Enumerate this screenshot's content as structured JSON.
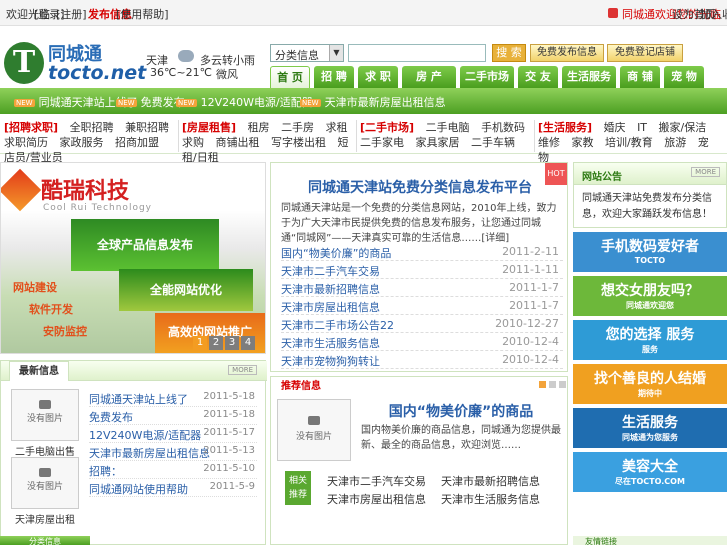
{
  "topbar": {
    "left_links": [
      "欢迎光临",
      "[登录]",
      "[注册]",
      "[退出登录]"
    ],
    "highlight": "发布信息",
    "help": "[使用帮助]",
    "right_promo": "同城通欢迎您的光临",
    "right_links": [
      "设为首页",
      "加入收藏"
    ]
  },
  "logo": {
    "mark": "T",
    "cn": "同城通",
    "en": "tocto.net"
  },
  "weather": {
    "city": "天津",
    "desc": "多云转小雨",
    "temp": "36℃~21℃",
    "wind": "微风"
  },
  "search": {
    "category": "分类信息",
    "placeholder": "",
    "button": "搜 索"
  },
  "action_buttons": [
    "免费发布信息",
    "免费登记店铺"
  ],
  "nav_tabs": [
    "首 页",
    "招 聘",
    "求 职",
    "房 产",
    "二手市场",
    "交 友",
    "生活服务",
    "商 铺",
    "宠 物"
  ],
  "green_bar": [
    {
      "tag": "NEW",
      "text": "同城通天津站上线了"
    },
    {
      "tag": "NEW",
      "text": "免费发布"
    },
    {
      "tag": "NEW",
      "text": "12V240W电源/适配器"
    },
    {
      "tag": "NEW",
      "text": "天津市最新房屋出租信息"
    }
  ],
  "categories": [
    {
      "head": "[招聘求职]",
      "links": [
        "全职招聘",
        "兼职招聘",
        "求职简历",
        "家政服务",
        "招商加盟",
        "店员/营业员"
      ]
    },
    {
      "head": "[房屋租售]",
      "links": [
        "租房",
        "二手房",
        "求租求购",
        "商铺出租",
        "写字楼出租",
        "短租/日租"
      ]
    },
    {
      "head": "[二手市场]",
      "links": [
        "二手电脑",
        "手机数码",
        "二手家电",
        "家具家居",
        "二手车辆"
      ]
    },
    {
      "head": "[生活服务]",
      "links": [
        "婚庆",
        "IT",
        "搬家/保洁",
        "维修",
        "家教",
        "培训/教育",
        "旅游",
        "宠物"
      ]
    }
  ],
  "banner": {
    "brand": "酷瑞科技",
    "brand_en": "Cool Rui Technology",
    "block1": "全球产品信息发布",
    "block2": "全能网站优化",
    "block3": "高效的网站推广",
    "side": [
      "网站建设",
      "软件开发",
      "安防监控"
    ],
    "pages": [
      "1",
      "2",
      "3",
      "4"
    ]
  },
  "headline": {
    "title": "同城通天津站免费分类信息发布平台",
    "summary": "同城通天津站是一个免费的分类信息网站，2010年上线，致力于为广大天津市民提供免费的信息发布服务，让您通过同城通“同城网”——天津真实可靠的生活信息……[详细]",
    "hot": "HOT",
    "news": [
      {
        "title": "国内“物美价廉”的商品",
        "date": "2011-2-11"
      },
      {
        "title": "天津市二手汽车交易",
        "date": "2011-1-11"
      },
      {
        "title": "天津市最新招聘信息",
        "date": "2011-1-7"
      },
      {
        "title": "天津市房屋出租信息",
        "date": "2011-1-7"
      },
      {
        "title": "天津市二手市场公告22",
        "date": "2010-12-27"
      },
      {
        "title": "天津市生活服务信息",
        "date": "2010-12-4"
      },
      {
        "title": "天津市宠物狗狗转让",
        "date": "2010-12-4"
      }
    ]
  },
  "notice": {
    "label": "网站公告",
    "more": "MORE",
    "body": "同城通天津站免费发布分类信息，欢迎大家踊跃发布信息！"
  },
  "right_ads": [
    {
      "big": "手机数码爱好者",
      "small": "TOCTO",
      "color": "#3a8fd0"
    },
    {
      "big": "想交女朋友吗？",
      "small": "同城通欢迎您",
      "color": "#6db83a"
    },
    {
      "big": "您的选择 服务",
      "small": "服务",
      "color": "#2e9bd6"
    },
    {
      "big": "找个善良的人结婚",
      "small": "期待中",
      "color": "#f0a020"
    },
    {
      "big": "生活服务",
      "small": "同城通为您服务",
      "color": "#1f6db0"
    },
    {
      "big": "美容大全",
      "small": "尽在TOCTO.COM",
      "color": "#3aa0e0"
    }
  ],
  "newlist": {
    "tab": "最新信息",
    "more": "MORE",
    "thumbs": [
      {
        "label": "没有图片",
        "caption": "二手电脑出售"
      },
      {
        "label": "没有图片",
        "caption": "天津房屋出租"
      }
    ],
    "rows": [
      {
        "title": "同城通天津站上线了",
        "date": "2011-5-18"
      },
      {
        "title": "免费发布",
        "date": "2011-5-18"
      },
      {
        "title": "12V240W电源/适配器",
        "date": "2011-5-17"
      },
      {
        "title": "天津市最新房屋出租信息",
        "date": "2011-5-13"
      },
      {
        "title": "招聘：",
        "date": "2011-5-10"
      },
      {
        "title": "同城通网站使用帮助",
        "date": "2011-5-9"
      }
    ]
  },
  "featured": {
    "label": "推荐信息",
    "pic": "没有图片",
    "title": "国内“物美价廉”的商品",
    "summary": "国内物美价廉的商品信息，同城通为您提供最新、最全的商品信息，欢迎浏览……",
    "related_label": "相关推荐",
    "related": [
      "天津市二手汽车交易",
      "天津市最新招聘信息",
      "天津市房屋出租信息",
      "天津市生活服务信息"
    ]
  },
  "bottom": {
    "tab": "分类信息",
    "right": "友情链接"
  }
}
